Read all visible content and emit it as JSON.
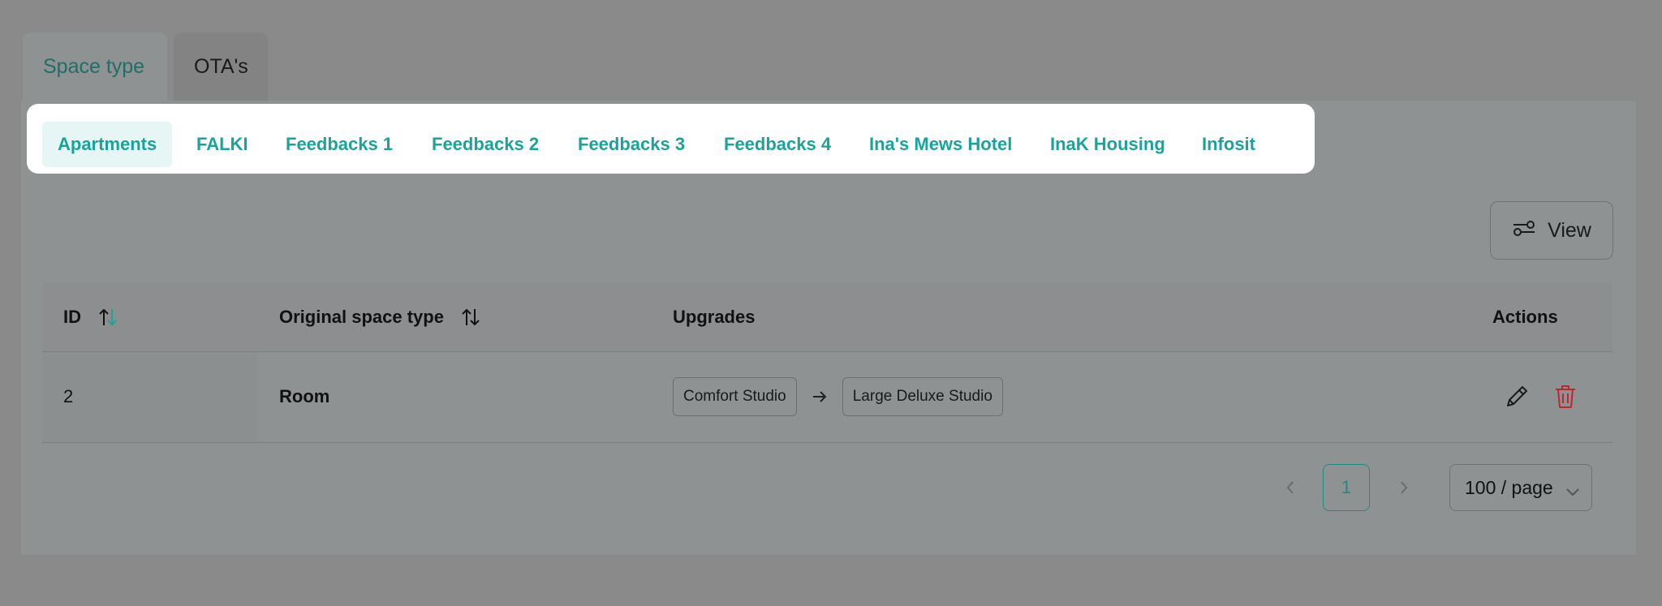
{
  "outer_tabs": [
    {
      "label": "Space type",
      "active": true
    },
    {
      "label": "OTA's",
      "active": false
    }
  ],
  "sub_tabs": [
    {
      "label": "Apartments",
      "selected": true
    },
    {
      "label": "FALKI"
    },
    {
      "label": "Feedbacks 1"
    },
    {
      "label": "Feedbacks 2"
    },
    {
      "label": "Feedbacks 3"
    },
    {
      "label": "Feedbacks 4"
    },
    {
      "label": "Ina's Mews Hotel"
    },
    {
      "label": "InaK Housing"
    },
    {
      "label": "Infosit"
    }
  ],
  "view_button": {
    "label": "View",
    "icon": "settings-sliders-icon"
  },
  "table": {
    "columns": [
      {
        "label": "ID",
        "sortable": true
      },
      {
        "label": "Original space type",
        "sortable": true
      },
      {
        "label": "Upgrades",
        "sortable": false
      },
      {
        "label": "Actions",
        "sortable": false
      }
    ],
    "rows": [
      {
        "id": "2",
        "original": "Room",
        "upgrade_from": "Comfort Studio",
        "upgrade_to": "Large Deluxe Studio"
      }
    ]
  },
  "pagination": {
    "current_page": "1",
    "page_size": "100 / page"
  },
  "colors": {
    "accent": "#1aa39a",
    "delete": "#c0262d",
    "overlay": "#8a8a8a"
  }
}
